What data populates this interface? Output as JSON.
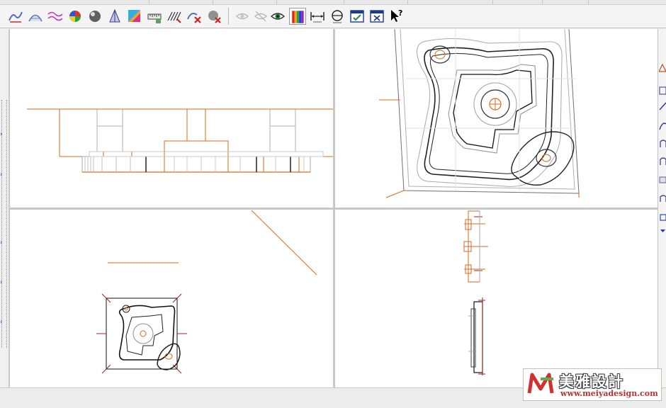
{
  "toolbar": {
    "buttons": [
      {
        "name": "surface-wave-icon"
      },
      {
        "name": "surface-curve-icon"
      },
      {
        "name": "surface-ripple-icon"
      },
      {
        "name": "color-sphere-icon"
      },
      {
        "name": "shaded-sphere-icon"
      },
      {
        "name": "cone-surface-icon"
      },
      {
        "name": "color-gradient-icon"
      },
      {
        "name": "ruler-measure-icon"
      },
      {
        "name": "hatch-surface-icon"
      },
      {
        "name": "delete-surface-icon"
      },
      {
        "name": "delete-shaded-icon"
      },
      {
        "name": "eye-dim-icon"
      },
      {
        "name": "eye-cross-icon"
      },
      {
        "name": "eye-view-icon"
      },
      {
        "name": "color-bars-icon"
      },
      {
        "name": "dimension-horizontal-icon"
      },
      {
        "name": "dimension-circle-icon"
      },
      {
        "name": "window-check-icon"
      },
      {
        "name": "window-close-icon"
      },
      {
        "name": "help-pointer-icon"
      }
    ]
  },
  "colors": {
    "orange": "#d86a1e",
    "dark_red": "#a02020",
    "gray_line": "#a8a8a8",
    "black_line": "#111111"
  },
  "watermark": {
    "name": "美雅設計",
    "url": "www.meiyadesign.com"
  }
}
